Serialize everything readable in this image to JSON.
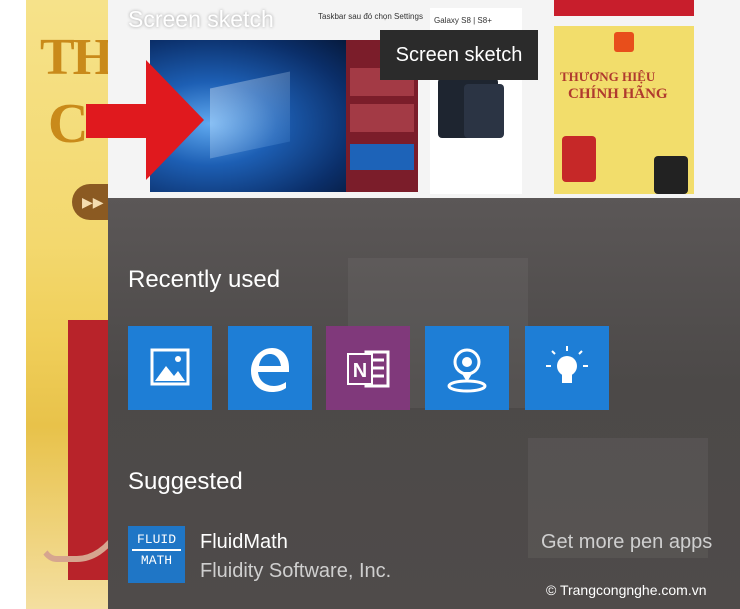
{
  "window": {
    "title": "Screen sketch",
    "tooltip": "Screen sketch"
  },
  "thumbnail": {
    "toolbar_snippet": "Taskbar sau đó chọn Settings",
    "product_label": "Galaxy S8 | S8+",
    "promo_heading_1": "THƯƠNG HIỆU",
    "promo_heading_2": "CHÍNH HÃNG"
  },
  "recently_used": {
    "heading": "Recently used",
    "apps": [
      {
        "icon": "photos-icon",
        "color": "#1e7ed6"
      },
      {
        "icon": "edge-icon",
        "color": "#1e7ed6"
      },
      {
        "icon": "onenote-icon",
        "color": "#80397b"
      },
      {
        "icon": "maps-icon",
        "color": "#1e7ed6"
      },
      {
        "icon": "tips-icon",
        "color": "#1e7ed6"
      }
    ]
  },
  "suggested": {
    "heading": "Suggested",
    "app": {
      "logo_line1": "FLUID",
      "logo_line2": "MATH",
      "name": "FluidMath",
      "publisher": "Fluidity Software, Inc."
    },
    "more_link": "Get more pen apps"
  },
  "watermark": "© Trangcongnghe.com.vn",
  "colors": {
    "panel": "#4c4948",
    "tile_blue": "#1e7ed6",
    "tile_purple": "#80397b",
    "arrow_red": "#e0191e"
  }
}
